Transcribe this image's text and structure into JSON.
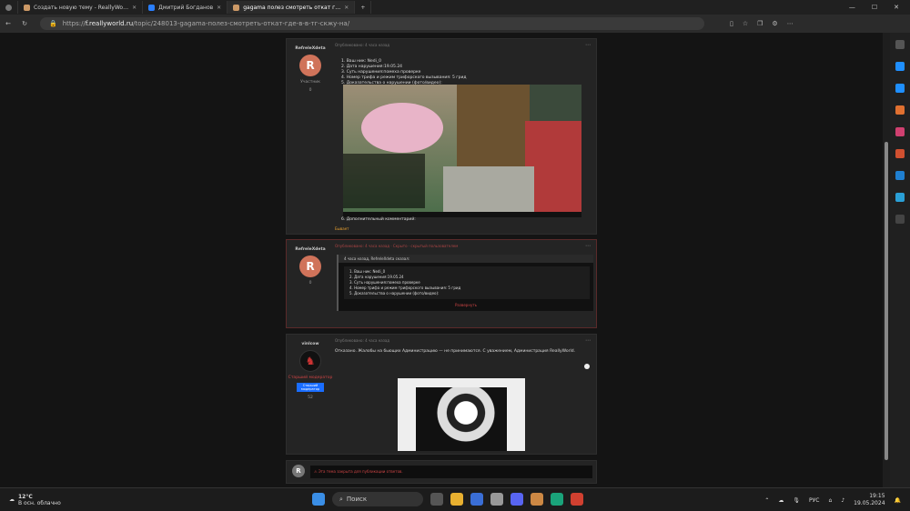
{
  "browser": {
    "tabs": [
      {
        "label": "Создать новую тему - ReallyWo…",
        "active": false
      },
      {
        "label": "Дмитрий Богданов",
        "active": false
      },
      {
        "label": "gagama полез смотреть откат г…",
        "active": true
      }
    ],
    "url_prefix": "https://",
    "url_host": "f.reallyworld.ru",
    "url_path": "/topic/248013-gagama-полез-смотреть-откат-где-в-в-тг-скжу-на/"
  },
  "posts": [
    {
      "author": "RefreleXdeta",
      "role": "Участник",
      "rep": "0",
      "meta": "Опубликовано: 4 часа назад",
      "list": [
        "1. Ваш ник: Nedi_0",
        "2. Дата нарушения:19.05.24",
        "3. Суть нарушения:помеха проверке",
        "4. Номер трифа и режим трифорского вызывания: 5 грид",
        "5. Доказательства о нарушении (фото/видео):"
      ],
      "extra": "6. Дополнительный комментарий:",
      "likes": "Бывает"
    },
    {
      "author": "RefreleXdeta",
      "rep": "0",
      "meta": "Опубликовано: 4 часа назад · Скрыто · скрытый пользователем",
      "quote_head": "4 часа назад, RefreleXdeta сказал:",
      "quote_list": [
        "1. Ваш ник: Nedi_0",
        "2. Дата нарушения:19.05.24",
        "3. Суть нарушения:помеха проверке",
        "4. Номер трифа и режим трифорского вызывания: 5 грид",
        "5. Доказательства о нарушении (фото/видео):"
      ],
      "expand": "Развернуть"
    },
    {
      "author": "vinlcow",
      "role": "Старший модератор",
      "badge": "Старший модератор",
      "rep": "52",
      "meta": "Опубликовано: 4 часа назад",
      "text": "Отказано. Жалобы на бьющих Администрацию — не принимаются. С уважением, Администрация ReallyWorld."
    }
  ],
  "reply": {
    "notice": "⚠ Эта тема закрыта для публикации ответов."
  },
  "taskbar": {
    "temp": "12°C",
    "weather": "В осн. облачно",
    "search": "Поиск",
    "lang": "РУС",
    "time": "19:15",
    "date": "19.05.2024"
  },
  "colors": {
    "avatar": "#d0735a",
    "accent_red": "#c44444",
    "badge_blue": "#1a6dff"
  }
}
